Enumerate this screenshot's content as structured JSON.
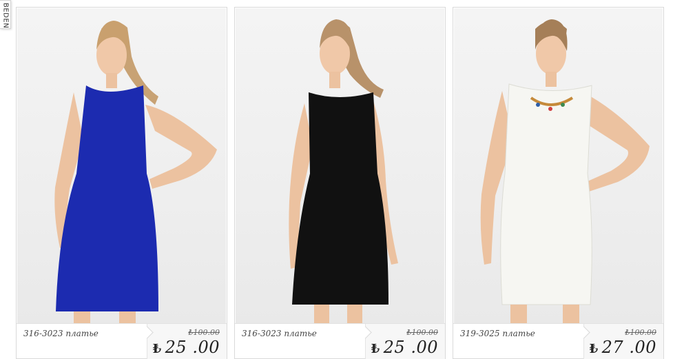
{
  "side_tab": {
    "label": "BEDEN"
  },
  "products": [
    {
      "title": "316-3023 платье",
      "old_price": "₺100.00",
      "currency": "₺",
      "price": "25 .00",
      "dress_color": "#1c2bb0",
      "dress_name": "blue dress"
    },
    {
      "title": "316-3023 платье",
      "old_price": "₺100.00",
      "currency": "₺",
      "price": "25 .00",
      "dress_color": "#111111",
      "dress_name": "black dress"
    },
    {
      "title": "319-3025 платье",
      "old_price": "₺100.00",
      "currency": "₺",
      "price": "27 .00",
      "dress_color": "#f6f6f2",
      "dress_name": "white dress"
    }
  ]
}
